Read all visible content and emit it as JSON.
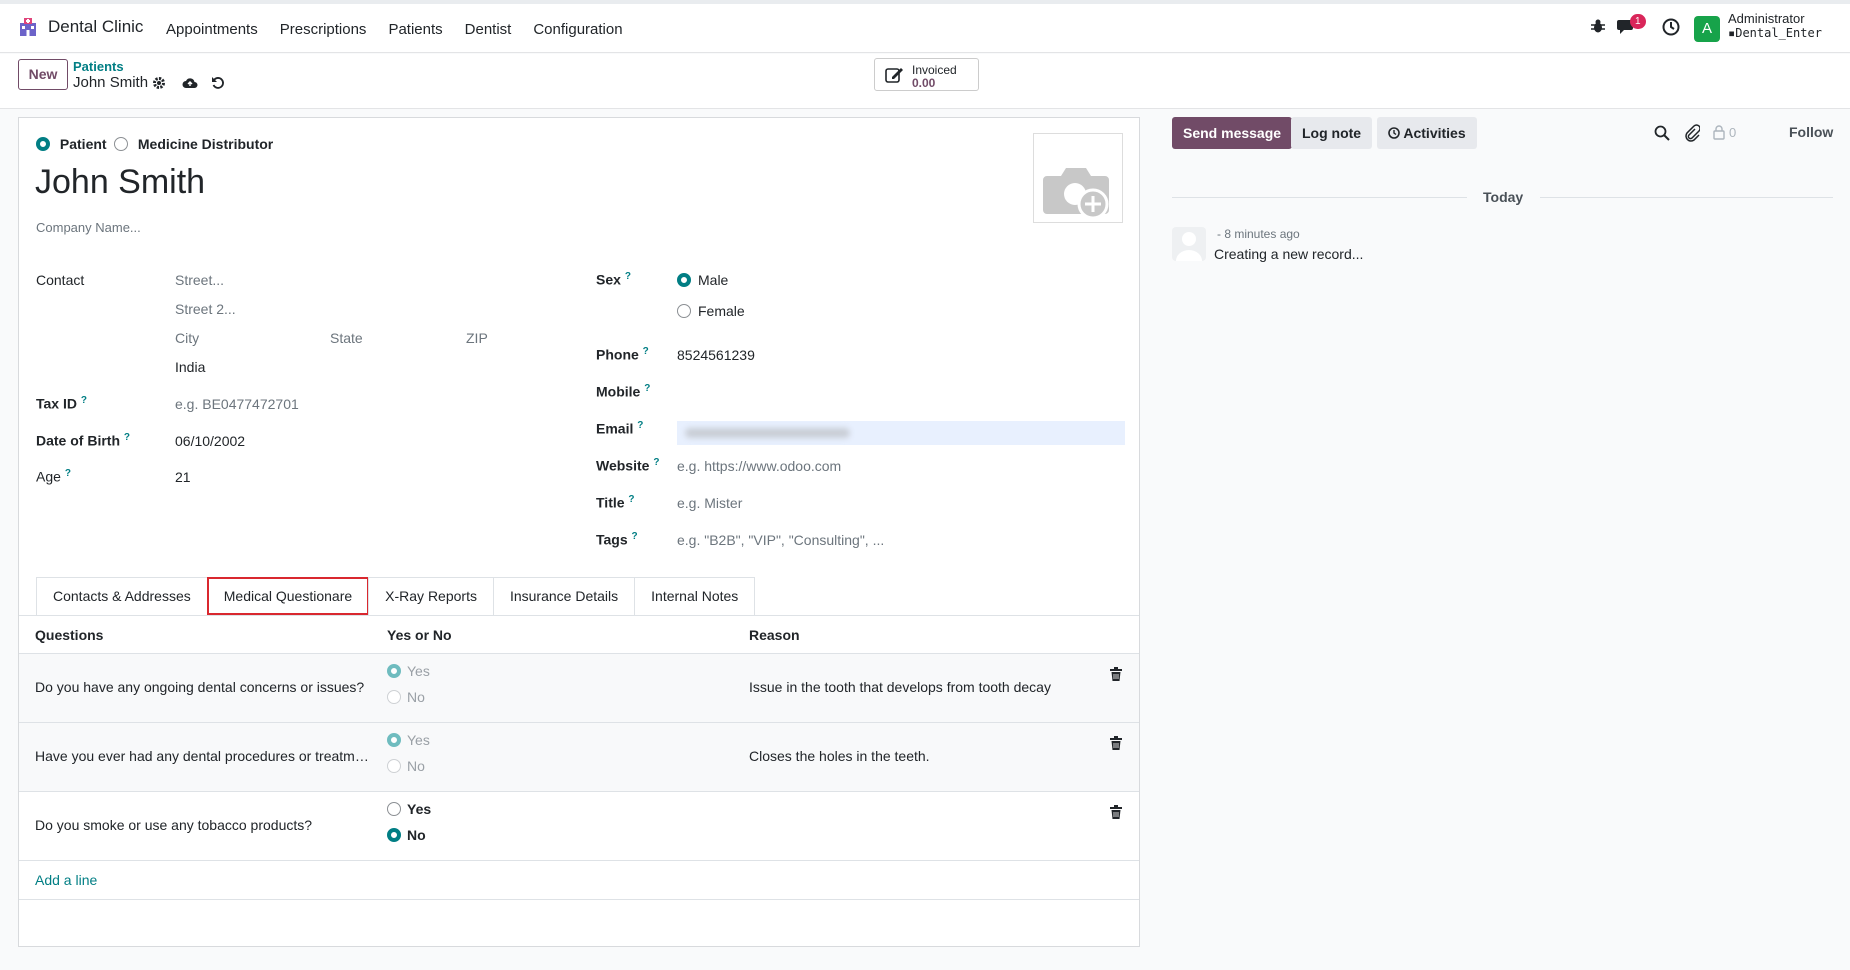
{
  "app": {
    "name": "Dental Clinic",
    "menu": [
      "Appointments",
      "Prescriptions",
      "Patients",
      "Dentist",
      "Configuration"
    ],
    "notification_count": "1",
    "user": {
      "initial": "A",
      "name": "Administrator",
      "db": "Dental_Enter"
    }
  },
  "control": {
    "new_label": "New",
    "breadcrumb_parent": "Patients",
    "breadcrumb_current": "John Smith",
    "invoiced_label": "Invoiced",
    "invoiced_value": "0.00"
  },
  "form": {
    "type_options": [
      "Patient",
      "Medicine Distributor"
    ],
    "name": "John Smith",
    "company_placeholder": "Company Name...",
    "contact_label": "Contact",
    "street_placeholder": "Street...",
    "street2_placeholder": "Street 2...",
    "city_placeholder": "City",
    "state_placeholder": "State",
    "zip_placeholder": "ZIP",
    "country": "India",
    "tax_id_label": "Tax ID",
    "tax_id_placeholder": "e.g. BE0477472701",
    "dob_label": "Date of Birth",
    "dob_value": "06/10/2002",
    "age_label": "Age",
    "age_value": "21",
    "sex_label": "Sex",
    "sex_male": "Male",
    "sex_female": "Female",
    "phone_label": "Phone",
    "phone_value": "8524561239",
    "mobile_label": "Mobile",
    "email_label": "Email",
    "website_label": "Website",
    "website_placeholder": "e.g. https://www.odoo.com",
    "title_label": "Title",
    "title_placeholder": "e.g. Mister",
    "tags_label": "Tags",
    "tags_placeholder": "e.g. \"B2B\", \"VIP\", \"Consulting\", ...",
    "help_mark": "?"
  },
  "tabs": [
    "Contacts & Addresses",
    "Medical Questionare",
    "X-Ray Reports",
    "Insurance Details",
    "Internal Notes"
  ],
  "questionnaire": {
    "headers": {
      "question": "Questions",
      "answer": "Yes or No",
      "reason": "Reason"
    },
    "yes_label": "Yes",
    "no_label": "No",
    "rows": [
      {
        "question": "Do you have any ongoing dental concerns or issues?",
        "answer": "yes",
        "reason": "Issue in the tooth that develops from tooth decay"
      },
      {
        "question": "Have you ever had any dental procedures or treatments?",
        "answer": "yes",
        "reason": "Closes the holes in the teeth."
      },
      {
        "question": "Do you smoke or use any tobacco products?",
        "answer": "no",
        "reason": ""
      }
    ],
    "add_line": "Add a line"
  },
  "chatter": {
    "send_message": "Send message",
    "log_note": "Log note",
    "activities": "Activities",
    "follower_count": "0",
    "follow": "Follow",
    "today": "Today",
    "message_time": "- 8 minutes ago",
    "message_body": "Creating a new record..."
  }
}
